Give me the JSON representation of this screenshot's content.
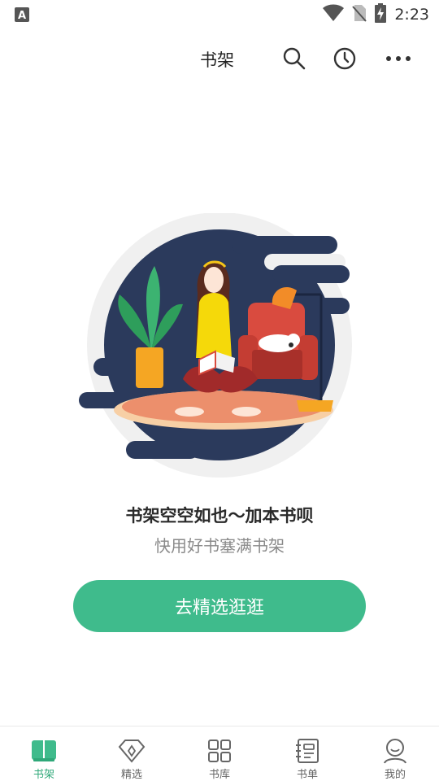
{
  "status_bar": {
    "time": "2:23",
    "left_icon": "a-notification-icon",
    "icons": [
      "wifi-icon",
      "no-sim-icon",
      "battery-charging-icon"
    ]
  },
  "header": {
    "title": "书架",
    "actions": [
      "search-icon",
      "history-clock-icon",
      "more-icon"
    ]
  },
  "empty_state": {
    "title": "书架空空如也～加本书呗",
    "subtitle": "快用好书塞满书架",
    "button_label": "去精选逛逛"
  },
  "tabs": [
    {
      "label": "书架",
      "icon": "bookshelf-icon",
      "active": true
    },
    {
      "label": "精选",
      "icon": "diamond-icon",
      "active": false
    },
    {
      "label": "书库",
      "icon": "grid-icon",
      "active": false
    },
    {
      "label": "书单",
      "icon": "notebook-icon",
      "active": false
    },
    {
      "label": "我的",
      "icon": "profile-icon",
      "active": false
    }
  ],
  "colors": {
    "accent": "#3fbb8c",
    "tab_active": "#2fa879",
    "illustration_navy": "#2b3a5c"
  }
}
